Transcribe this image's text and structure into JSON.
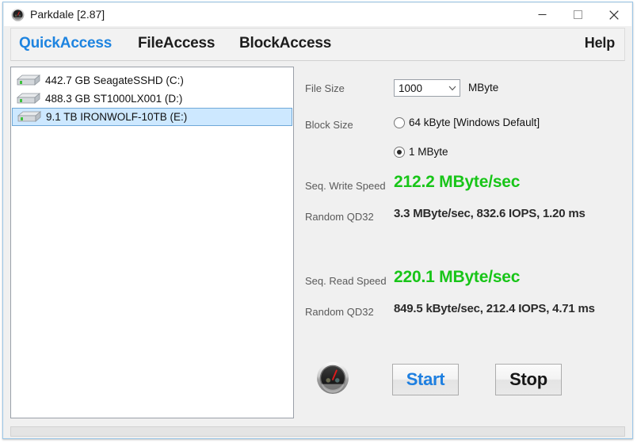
{
  "window": {
    "title": "Parkdale [2.87]",
    "icon": "speedometer-icon",
    "minimize_label": "Minimize",
    "maximize_label": "Maximize",
    "close_label": "Close"
  },
  "tabs": [
    {
      "label": "QuickAccess",
      "active": true
    },
    {
      "label": "FileAccess",
      "active": false
    },
    {
      "label": "BlockAccess",
      "active": false
    }
  ],
  "help": {
    "label": "Help"
  },
  "drives": [
    {
      "label": "442.7 GB SeagateSSHD (C:)",
      "selected": false
    },
    {
      "label": "488.3 GB ST1000LX001 (D:)",
      "selected": false
    },
    {
      "label": "9.1 TB IRONWOLF-10TB (E:)",
      "selected": true
    }
  ],
  "settings": {
    "file_size_label": "File Size",
    "file_size_value": "1000",
    "file_size_unit": "MByte",
    "block_size_label": "Block Size",
    "block_options": [
      {
        "label": "64 kByte [Windows Default]",
        "selected": false
      },
      {
        "label": "1 MByte",
        "selected": true
      }
    ]
  },
  "results": {
    "write": {
      "speed_label": "Seq. Write Speed",
      "speed_value": "212.2 MByte/sec",
      "random_label": "Random QD32",
      "random_value": "3.3 MByte/sec, 832.6 IOPS, 1.20 ms"
    },
    "read": {
      "speed_label": "Seq. Read Speed",
      "speed_value": "220.1 MByte/sec",
      "random_label": "Random QD32",
      "random_value": "849.5 kByte/sec, 212.4 IOPS, 4.71 ms"
    }
  },
  "actions": {
    "start_label": "Start",
    "stop_label": "Stop",
    "gauge_icon": "speedometer-icon"
  },
  "colors": {
    "accent_blue": "#1e84e0",
    "speed_green": "#18c518",
    "selection_blue": "#cde8ff"
  }
}
